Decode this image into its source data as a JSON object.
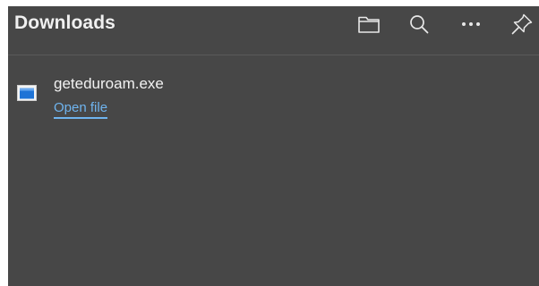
{
  "header": {
    "title": "Downloads",
    "icons": [
      "folder-icon",
      "search-icon",
      "more-icon",
      "pin-icon"
    ]
  },
  "downloads": [
    {
      "filename": "geteduroam.exe",
      "action_label": "Open file",
      "icon": "exe-file-icon"
    }
  ],
  "colors": {
    "panel_bg": "#474747",
    "link": "#6fb4ef",
    "text": "#f2f2f2"
  }
}
